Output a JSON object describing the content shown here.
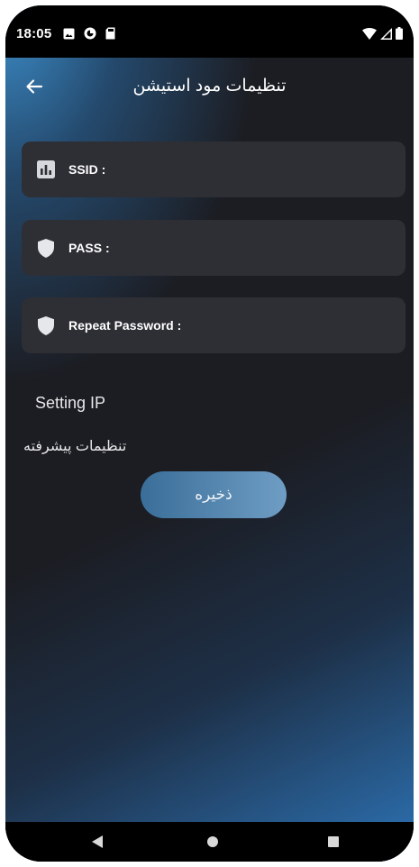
{
  "status_bar": {
    "time": "18:05",
    "left_icons": [
      "image-notification-icon",
      "sync-notification-icon",
      "sd-card-icon"
    ],
    "right_icons": [
      "wifi-icon",
      "signal-icon",
      "battery-icon"
    ]
  },
  "header": {
    "title": "تنظیمات مود استیشن",
    "back_icon": "arrow-left-icon"
  },
  "fields": [
    {
      "icon": "bar-chart-icon",
      "label": "SSID :",
      "value": ""
    },
    {
      "icon": "shield-icon",
      "label": "PASS :",
      "value": ""
    },
    {
      "icon": "shield-icon",
      "label": "Repeat Password :",
      "value": ""
    }
  ],
  "setting_ip": "Setting IP",
  "advanced_settings": "تنظیمات پیشرفته",
  "save_button": "ذخیره",
  "nav_bar": {
    "back": "nav-back-triangle-icon",
    "home": "nav-home-circle-icon",
    "recents": "nav-recents-square-icon"
  },
  "colors": {
    "background": "#1c1d23",
    "field_background": "#2e2f35",
    "accent_blue": "#3f96d6",
    "button_gradient_start": "#3a6e98",
    "button_gradient_end": "#6f9dc4"
  }
}
